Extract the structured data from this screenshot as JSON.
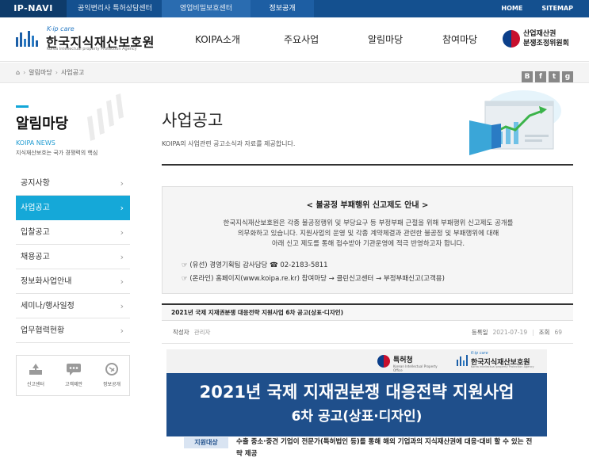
{
  "topbar": {
    "brand": "IP-NAVI",
    "tabs": [
      "공익변리사 특허상담센터",
      "영업비밀보호센터",
      "정보공개"
    ],
    "links": [
      "HOME",
      "SITEMAP"
    ]
  },
  "header": {
    "logo_tagline": "K-ip care",
    "logo_name": "한국지식재산보호원",
    "logo_en": "Korea Intellectual property Protection Agency",
    "nav": [
      "KOIPA소개",
      "주요사업",
      "알림마당",
      "참여마당"
    ],
    "partner_line1": "산업재산권",
    "partner_line2": "분쟁조정위원회"
  },
  "breadcrumb": {
    "home_icon": "home-icon",
    "items": [
      "알림마당",
      "사업공고"
    ],
    "sns": [
      "B",
      "f",
      "t",
      "g"
    ]
  },
  "sidebar": {
    "title": "알림마당",
    "en": "KOIPA NEWS",
    "sub": "지식재산보호는 국가 경쟁력의 핵심",
    "items": [
      {
        "label": "공지사항"
      },
      {
        "label": "사업공고"
      },
      {
        "label": "입찰공고"
      },
      {
        "label": "채용공고"
      },
      {
        "label": "정보화사업안내"
      },
      {
        "label": "세미나/행사일정"
      },
      {
        "label": "업무협력현황"
      }
    ],
    "active_index": 1,
    "quick": [
      {
        "label": "신고센터",
        "icon": "report-icon"
      },
      {
        "label": "고객제안",
        "icon": "chat-icon"
      },
      {
        "label": "정보공개",
        "icon": "search-doc-icon"
      }
    ]
  },
  "main": {
    "title": "사업공고",
    "desc": "KOIPA의 사업관련 공고소식과 자료를 제공합니다.",
    "notice": {
      "title": "< 불공정 부패행위 신고제도 안내 >",
      "para1": "한국지식재산보호원은 각종 불공정행위 및 부당요구 등 부정부패 근절을 위해 부패행위 신고제도 공개를",
      "para2": "의무화하고 있습니다. 지원사업의 운영 및 각종 계약체결과 관련한 불공정 및 부패행위에 대해",
      "para3": "아래 신고 제도를 통해 접수받아 기관운영에 적극 반영하고자 합니다.",
      "line1": "☞ (유선) 경영기획팀 감사담당 ☎ 02-2183-5811",
      "line2": "☞ (온라인) 홈페이지(www.koipa.re.kr) 참여마당 → 클린신고센터 → 부정부패신고(고객용)"
    },
    "post": {
      "title": "2021년 국제 지재권분쟁 대응전략 지원사업 6차 공고(상표·디자인)",
      "author_label": "작성자",
      "author": "관리자",
      "date_label": "등록일",
      "date": "2021-07-19",
      "views_label": "조회",
      "views": "69"
    },
    "poster": {
      "kipo_name": "특허청",
      "kipo_en": "Korean Intellectual Property Office",
      "koipa_tag": "K-ip care",
      "koipa_name": "한국지식재산보호원",
      "koipa_en": "Korea Intellectual property Protection Agency",
      "headline1": "2021년 국제 지재권분쟁 대응전략 지원사업",
      "headline2": "6차 공고(상표·디자인)",
      "tag": "지원대상",
      "target": "수출 중소·중견 기업이 전문가(특허법인 등)를 통해 해외 기업과의 지식재산권에 대응·대비 할 수 있는 전략 제공"
    }
  },
  "colors": {
    "topbar": "#14508f",
    "accent": "#15a8d8",
    "poster_band": "#1f4f8b"
  }
}
